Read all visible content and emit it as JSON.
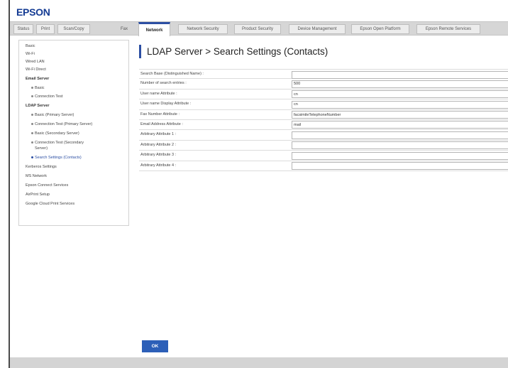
{
  "brand": {
    "logo_text": "EPSON",
    "accent_color": "#2c4fa3",
    "logo_color": "#143b93"
  },
  "tabs": [
    {
      "label": "Status"
    },
    {
      "label": "Print"
    },
    {
      "label": "Scan/Copy"
    },
    {
      "label": "Fax"
    },
    {
      "label": "Network",
      "active": true
    },
    {
      "label": "Network Security"
    },
    {
      "label": "Product Security"
    },
    {
      "label": "Device Management"
    },
    {
      "label": "Epson Open Platform"
    },
    {
      "label": "Epson Remote Services"
    }
  ],
  "sidebar": {
    "items": [
      {
        "label": "Basic"
      },
      {
        "label": "Wi-Fi"
      },
      {
        "label": "Wired LAN"
      },
      {
        "label": "Wi-Fi Direct"
      },
      {
        "label": "Email Server",
        "header": true
      },
      {
        "label": "Basic"
      },
      {
        "label": "Connection Test"
      },
      {
        "label": "LDAP Server",
        "header": true
      },
      {
        "label": "Basic (Primary Server)"
      },
      {
        "label": "Connection Test (Primary Server)"
      },
      {
        "label": "Basic (Secondary Server)"
      },
      {
        "label": "Connection Test (Secondary"
      },
      {
        "label": "Server)"
      },
      {
        "label": "Search Settings (Contacts)",
        "active": true
      },
      {
        "label": "Kerberos Settings"
      },
      {
        "label": "MS Network"
      },
      {
        "label": "Epson Connect Services"
      },
      {
        "label": "AirPrint Setup"
      },
      {
        "label": "Google Cloud Print Services"
      }
    ]
  },
  "main": {
    "title": "LDAP Server > Search Settings (Contacts)",
    "fields": [
      {
        "label": "Search Base (Distinguished Name) :",
        "value": ""
      },
      {
        "label": "Number of search entries :",
        "value": "500"
      },
      {
        "label": "User name Attribute :",
        "value": "cn"
      },
      {
        "label": "User name Display Attribute :",
        "value": "cn"
      },
      {
        "label": "Fax Number Attribute :",
        "value": "facsimileTelephoneNumber"
      },
      {
        "label": "Email Address Attribute :",
        "value": "mail"
      },
      {
        "label": "Arbitrary Attribute 1 :",
        "value": ""
      },
      {
        "label": "Arbitrary Attribute 2 :",
        "value": ""
      },
      {
        "label": "Arbitrary Attribute 3 :",
        "value": ""
      },
      {
        "label": "Arbitrary Attribute 4 :",
        "value": ""
      }
    ],
    "ok_label": "OK"
  }
}
